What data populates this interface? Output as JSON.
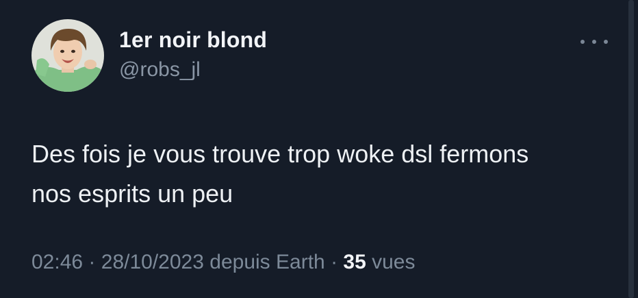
{
  "tweet": {
    "author": {
      "display_name": "1er noir blond",
      "handle": "@robs_jl",
      "avatar_icon": "user-avatar-photo"
    },
    "more_icon": "more-horizontal-icon",
    "text_line_1": "Des fois je vous trouve trop woke dsl fermons",
    "text_line_2": "nos esprits un peu",
    "meta": {
      "time": "02:46",
      "separator": "·",
      "date": "28/10/2023",
      "source": "depuis Earth",
      "views_count": "35",
      "views_label": "vues"
    }
  },
  "colors": {
    "background": "#151c28",
    "primary_text": "#eef1f4",
    "secondary_text": "#7d8a99"
  }
}
